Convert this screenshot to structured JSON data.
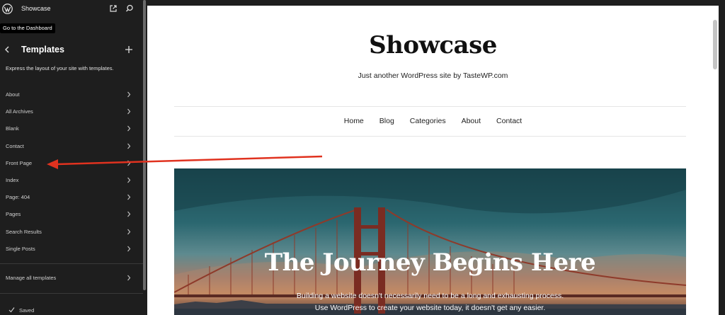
{
  "topbar": {
    "site_name": "Showcase",
    "tooltip": "Go to the Dashboard"
  },
  "panel": {
    "title": "Templates",
    "description": "Express the layout of your site with templates.",
    "templates": [
      {
        "label": "About"
      },
      {
        "label": "All Archives"
      },
      {
        "label": "Blank"
      },
      {
        "label": "Contact"
      },
      {
        "label": "Front Page"
      },
      {
        "label": "Index"
      },
      {
        "label": "Page: 404"
      },
      {
        "label": "Pages"
      },
      {
        "label": "Search Results"
      },
      {
        "label": "Single Posts"
      }
    ],
    "manage_label": "Manage all templates",
    "status": "Saved"
  },
  "preview": {
    "site_title": "Showcase",
    "tagline": "Just another WordPress site by TasteWP.com",
    "nav": [
      "Home",
      "Blog",
      "Categories",
      "About",
      "Contact"
    ],
    "hero_title": "The Journey Begins Here",
    "hero_text": "Building a website doesn't necessarily need to be a long and exhausting process. Use WordPress to create your website today, it doesn't get any easier."
  },
  "colors": {
    "sidebar_bg": "#1e1e1e",
    "annotation_arrow": "#e0321f"
  },
  "icons": [
    "wordpress-logo-icon",
    "external-link-icon",
    "search-icon",
    "back-chevron-icon",
    "plus-icon",
    "chevron-right-icon",
    "check-icon"
  ]
}
